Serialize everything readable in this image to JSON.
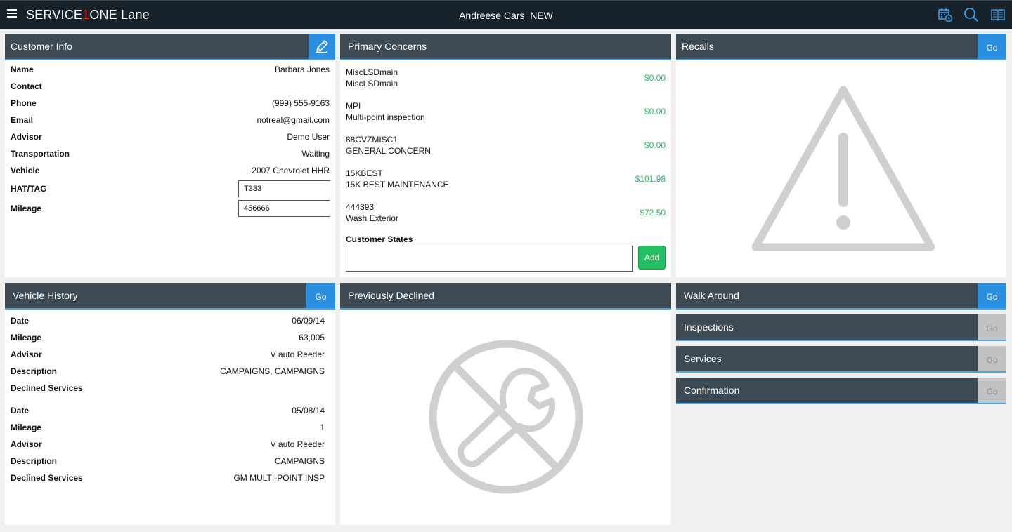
{
  "topbar": {
    "brand_part1": "SERVICE",
    "brand_accent": "1",
    "brand_part2": "ONE Lane",
    "center_title": "Andreese Cars  NEW",
    "icons": [
      "menu-icon",
      "calendar-clock-icon",
      "search-icon",
      "book-icon"
    ]
  },
  "customer_info": {
    "title": "Customer Info",
    "edit_icon": "edit-pen-icon",
    "fields": {
      "name": {
        "label": "Name",
        "value": "Barbara Jones"
      },
      "contact": {
        "label": "Contact",
        "value": ""
      },
      "phone": {
        "label": "Phone",
        "value": "(999) 555-9163"
      },
      "email": {
        "label": "Email",
        "value": "notreal@gmail.com"
      },
      "advisor": {
        "label": "Advisor",
        "value": "Demo User"
      },
      "transportation": {
        "label": "Transportation",
        "value": "Waiting"
      },
      "vehicle": {
        "label": "Vehicle",
        "value": "2007 Chevrolet HHR"
      },
      "hat_tag": {
        "label": "HAT/TAG",
        "value": "T333"
      },
      "mileage": {
        "label": "Mileage",
        "value": "456666"
      }
    }
  },
  "primary_concerns": {
    "title": "Primary Concerns",
    "items": [
      {
        "code": "MiscLSDmain",
        "desc": "MiscLSDmain",
        "price": "$0.00"
      },
      {
        "code": "MPI",
        "desc": "Multi-point inspection",
        "price": "$0.00"
      },
      {
        "code": "88CVZMISC1",
        "desc": "GENERAL CONCERN",
        "price": "$0.00"
      },
      {
        "code": "15KBEST",
        "desc": "15K BEST MAINTENANCE",
        "price": "$101.98"
      },
      {
        "code": "444393",
        "desc": "Wash Exterior",
        "price": "$72.50"
      }
    ],
    "customer_states_label": "Customer States",
    "customer_states_value": "",
    "add_label": "Add",
    "accent_color": "#2fb36b"
  },
  "recalls": {
    "title": "Recalls",
    "go_label": "Go",
    "empty_icon": "warning-triangle-icon"
  },
  "vehicle_history": {
    "title": "Vehicle History",
    "go_label": "Go",
    "entries": [
      {
        "date_label": "Date",
        "date": "06/09/14",
        "mileage_label": "Mileage",
        "mileage": "63,005",
        "advisor_label": "Advisor",
        "advisor": "V auto Reeder",
        "description_label": "Description",
        "description": "CAMPAIGNS, CAMPAIGNS",
        "declined_label": "Declined Services",
        "declined": ""
      },
      {
        "date_label": "Date",
        "date": "05/08/14",
        "mileage_label": "Mileage",
        "mileage": "1",
        "advisor_label": "Advisor",
        "advisor": "V auto Reeder",
        "description_label": "Description",
        "description": "CAMPAIGNS",
        "declined_label": "Declined Services",
        "declined": "GM MULTI-POINT INSP"
      }
    ]
  },
  "previously_declined": {
    "title": "Previously Declined",
    "empty_icon": "no-wrench-icon"
  },
  "workflow": {
    "walk_around": {
      "title": "Walk Around",
      "go_label": "Go",
      "enabled": true
    },
    "inspections": {
      "title": "Inspections",
      "go_label": "Go",
      "enabled": false
    },
    "services": {
      "title": "Services",
      "go_label": "Go",
      "enabled": false
    },
    "confirmation": {
      "title": "Confirmation",
      "go_label": "Go",
      "enabled": false
    }
  },
  "colors": {
    "topbar_bg": "#18222b",
    "header_bg": "#3d4a53",
    "accent_blue": "#2a8fe0",
    "price_green": "#2fb36b",
    "brand_red": "#e0291c"
  }
}
